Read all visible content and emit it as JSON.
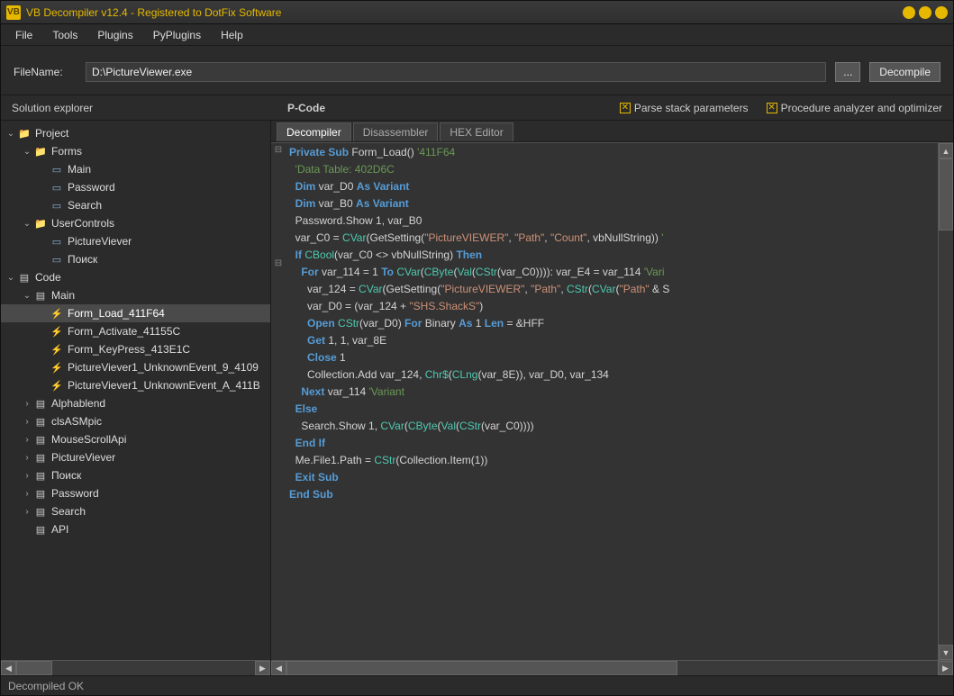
{
  "window": {
    "title": "VB Decompiler v12.4 - Registered to DotFix Software"
  },
  "menu": {
    "items": [
      "File",
      "Tools",
      "Plugins",
      "PyPlugins",
      "Help"
    ]
  },
  "toolbar": {
    "filename_label": "FileName:",
    "filename_value": "D:\\PictureViewer.exe",
    "browse_label": "...",
    "decompile_label": "Decompile"
  },
  "midbar": {
    "solution_label": "Solution explorer",
    "pcode_label": "P-Code",
    "chk1": "Parse stack parameters",
    "chk2": "Procedure analyzer and optimizer"
  },
  "tree": {
    "items": [
      {
        "d": 0,
        "exp": "v",
        "icon": "project",
        "label": "Project"
      },
      {
        "d": 1,
        "exp": "v",
        "icon": "folder",
        "label": "Forms"
      },
      {
        "d": 2,
        "exp": "",
        "icon": "form",
        "label": "Main"
      },
      {
        "d": 2,
        "exp": "",
        "icon": "form",
        "label": "Password"
      },
      {
        "d": 2,
        "exp": "",
        "icon": "form",
        "label": "Search"
      },
      {
        "d": 1,
        "exp": "v",
        "icon": "folder",
        "label": "UserControls"
      },
      {
        "d": 2,
        "exp": "",
        "icon": "form",
        "label": "PictureViever"
      },
      {
        "d": 2,
        "exp": "",
        "icon": "form",
        "label": "Поиск"
      },
      {
        "d": 0,
        "exp": "v",
        "icon": "code",
        "label": "Code"
      },
      {
        "d": 1,
        "exp": "v",
        "icon": "mod",
        "label": "Main"
      },
      {
        "d": 2,
        "exp": "",
        "icon": "proc",
        "label": "Form_Load_411F64",
        "selected": true
      },
      {
        "d": 2,
        "exp": "",
        "icon": "proc",
        "label": "Form_Activate_41155C"
      },
      {
        "d": 2,
        "exp": "",
        "icon": "proc",
        "label": "Form_KeyPress_413E1C"
      },
      {
        "d": 2,
        "exp": "",
        "icon": "proc",
        "label": "PictureViever1_UnknownEvent_9_4109"
      },
      {
        "d": 2,
        "exp": "",
        "icon": "proc",
        "label": "PictureViever1_UnknownEvent_A_411B"
      },
      {
        "d": 1,
        "exp": ">",
        "icon": "mod",
        "label": "Alphablend"
      },
      {
        "d": 1,
        "exp": ">",
        "icon": "mod",
        "label": "clsASMpic"
      },
      {
        "d": 1,
        "exp": ">",
        "icon": "mod",
        "label": "MouseScrollApi"
      },
      {
        "d": 1,
        "exp": ">",
        "icon": "mod",
        "label": "PictureViever"
      },
      {
        "d": 1,
        "exp": ">",
        "icon": "mod",
        "label": "Поиск"
      },
      {
        "d": 1,
        "exp": ">",
        "icon": "mod",
        "label": "Password"
      },
      {
        "d": 1,
        "exp": ">",
        "icon": "mod",
        "label": "Search"
      },
      {
        "d": 1,
        "exp": "",
        "icon": "mod",
        "label": "API"
      }
    ]
  },
  "tabs": {
    "items": [
      "Decompiler",
      "Disassembler",
      "HEX Editor"
    ],
    "active": 0
  },
  "code": {
    "lines": [
      [
        [
          "kw",
          "Private Sub"
        ],
        [
          "plain",
          " Form_Load() "
        ],
        [
          "cmt",
          "'411F64"
        ]
      ],
      [
        [
          "plain",
          "  "
        ],
        [
          "cmt",
          "'Data Table: 402D6C"
        ]
      ],
      [
        [
          "plain",
          "  "
        ],
        [
          "kw",
          "Dim"
        ],
        [
          "plain",
          " var_D0 "
        ],
        [
          "kw",
          "As Variant"
        ]
      ],
      [
        [
          "plain",
          "  "
        ],
        [
          "kw",
          "Dim"
        ],
        [
          "plain",
          " var_B0 "
        ],
        [
          "kw",
          "As Variant"
        ]
      ],
      [
        [
          "plain",
          "  Password.Show 1, var_B0"
        ]
      ],
      [
        [
          "plain",
          "  var_C0 = "
        ],
        [
          "fn",
          "CVar"
        ],
        [
          "plain",
          "(GetSetting("
        ],
        [
          "str",
          "\"PictureVIEWER\""
        ],
        [
          "plain",
          ", "
        ],
        [
          "str",
          "\"Path\""
        ],
        [
          "plain",
          ", "
        ],
        [
          "str",
          "\"Count\""
        ],
        [
          "plain",
          ", vbNullString)) "
        ],
        [
          "cmt",
          "'"
        ]
      ],
      [
        [
          "plain",
          "  "
        ],
        [
          "kw",
          "If"
        ],
        [
          "plain",
          " "
        ],
        [
          "fn",
          "CBool"
        ],
        [
          "plain",
          "(var_C0 <> vbNullString) "
        ],
        [
          "kw",
          "Then"
        ]
      ],
      [
        [
          "plain",
          "    "
        ],
        [
          "kw",
          "For"
        ],
        [
          "plain",
          " var_114 = 1 "
        ],
        [
          "kw",
          "To"
        ],
        [
          "plain",
          " "
        ],
        [
          "fn",
          "CVar"
        ],
        [
          "plain",
          "("
        ],
        [
          "fn",
          "CByte"
        ],
        [
          "plain",
          "("
        ],
        [
          "fn",
          "Val"
        ],
        [
          "plain",
          "("
        ],
        [
          "fn",
          "CStr"
        ],
        [
          "plain",
          "(var_C0)))): var_E4 = var_114 "
        ],
        [
          "cmt",
          "'Vari"
        ]
      ],
      [
        [
          "plain",
          "      var_124 = "
        ],
        [
          "fn",
          "CVar"
        ],
        [
          "plain",
          "(GetSetting("
        ],
        [
          "str",
          "\"PictureVIEWER\""
        ],
        [
          "plain",
          ", "
        ],
        [
          "str",
          "\"Path\""
        ],
        [
          "plain",
          ", "
        ],
        [
          "fn",
          "CStr"
        ],
        [
          "plain",
          "("
        ],
        [
          "fn",
          "CVar"
        ],
        [
          "plain",
          "("
        ],
        [
          "str",
          "\"Path\""
        ],
        [
          "plain",
          " & S"
        ]
      ],
      [
        [
          "plain",
          "      var_D0 = (var_124 + "
        ],
        [
          "str",
          "\"SHS.ShackS\""
        ],
        [
          "plain",
          ")"
        ]
      ],
      [
        [
          "plain",
          "      "
        ],
        [
          "kw",
          "Open"
        ],
        [
          "plain",
          " "
        ],
        [
          "fn",
          "CStr"
        ],
        [
          "plain",
          "(var_D0) "
        ],
        [
          "kw",
          "For"
        ],
        [
          "plain",
          " Binary "
        ],
        [
          "kw",
          "As"
        ],
        [
          "plain",
          " 1 "
        ],
        [
          "kw",
          "Len"
        ],
        [
          "plain",
          " = &HFF"
        ]
      ],
      [
        [
          "plain",
          "      "
        ],
        [
          "kw",
          "Get"
        ],
        [
          "plain",
          " 1, 1, var_8E"
        ]
      ],
      [
        [
          "plain",
          "      "
        ],
        [
          "kw",
          "Close"
        ],
        [
          "plain",
          " 1"
        ]
      ],
      [
        [
          "plain",
          "      Collection.Add var_124, "
        ],
        [
          "fn",
          "Chr$"
        ],
        [
          "plain",
          "("
        ],
        [
          "fn",
          "CLng"
        ],
        [
          "plain",
          "(var_8E)), var_D0, var_134"
        ]
      ],
      [
        [
          "plain",
          "    "
        ],
        [
          "kw",
          "Next"
        ],
        [
          "plain",
          " var_114 "
        ],
        [
          "cmt",
          "'Variant"
        ]
      ],
      [
        [
          "plain",
          "  "
        ],
        [
          "kw",
          "Else"
        ]
      ],
      [
        [
          "plain",
          "    Search.Show 1, "
        ],
        [
          "fn",
          "CVar"
        ],
        [
          "plain",
          "("
        ],
        [
          "fn",
          "CByte"
        ],
        [
          "plain",
          "("
        ],
        [
          "fn",
          "Val"
        ],
        [
          "plain",
          "("
        ],
        [
          "fn",
          "CStr"
        ],
        [
          "plain",
          "(var_C0))))"
        ]
      ],
      [
        [
          "plain",
          "  "
        ],
        [
          "kw",
          "End If"
        ]
      ],
      [
        [
          "plain",
          "  Me.File1.Path = "
        ],
        [
          "fn",
          "CStr"
        ],
        [
          "plain",
          "(Collection.Item(1))"
        ]
      ],
      [
        [
          "plain",
          "  "
        ],
        [
          "kw",
          "Exit Sub"
        ]
      ],
      [
        [
          "kw",
          "End Sub"
        ]
      ]
    ]
  },
  "status": {
    "text": "Decompiled OK"
  }
}
